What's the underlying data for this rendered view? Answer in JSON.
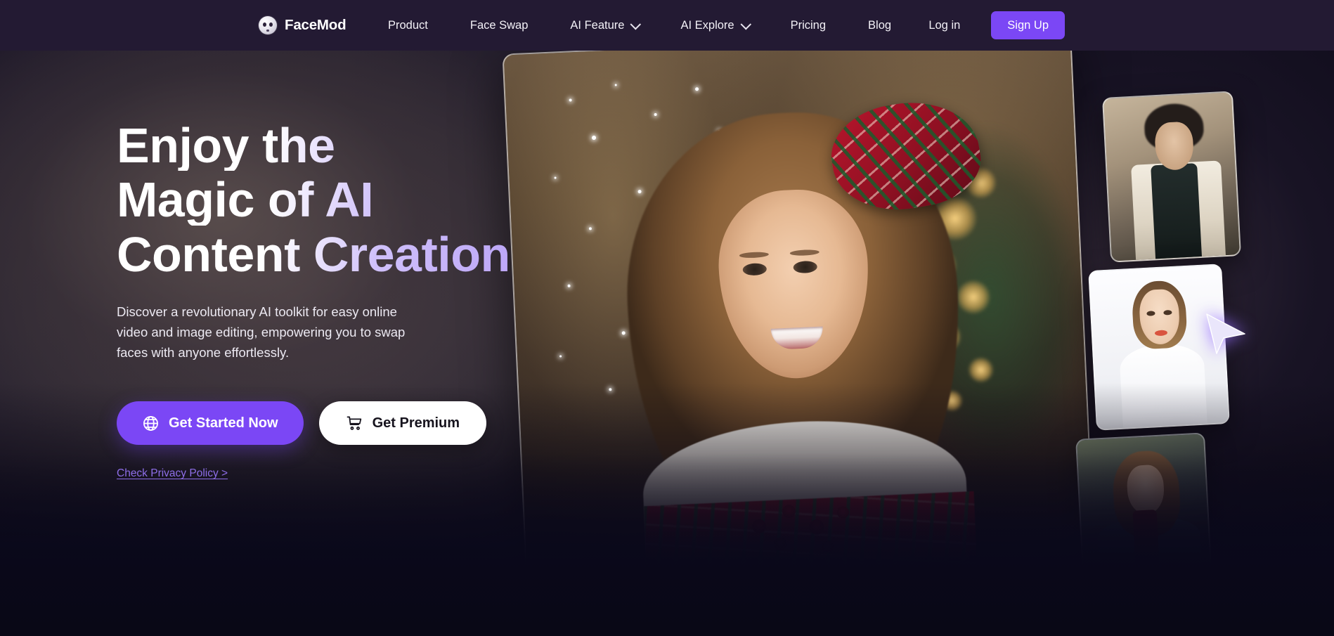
{
  "brand": {
    "name": "FaceMod",
    "logo_icon": "face-circle-icon"
  },
  "nav": {
    "links": [
      {
        "label": "Product",
        "has_dropdown": false
      },
      {
        "label": "Face Swap",
        "has_dropdown": false
      },
      {
        "label": "AI Feature",
        "has_dropdown": true
      },
      {
        "label": "AI Explore",
        "has_dropdown": true
      },
      {
        "label": "Pricing",
        "has_dropdown": false
      },
      {
        "label": "Blog",
        "has_dropdown": false
      }
    ],
    "login_label": "Log in",
    "signup_label": "Sign Up",
    "bar_color": "#231a33",
    "accent_color": "#7b47f5"
  },
  "hero": {
    "headline_line1": "Enjoy the",
    "headline_line2": "Magic of AI",
    "headline_line3": "Content Creation",
    "subtext": "Discover a revolutionary AI toolkit for easy online video and image editing, empowering you to swap faces with anyone effortlessly.",
    "primary_cta": "Get Started Now",
    "primary_cta_icon": "globe-icon",
    "secondary_cta": "Get Premium",
    "secondary_cta_icon": "shopping-cart-icon",
    "privacy_link": "Check Privacy Policy >",
    "headline_gradient_start": "#ffffff",
    "headline_gradient_end": "#b59cf7",
    "link_color": "#8e6ee8"
  },
  "gallery": {
    "main_image_alt": "Smiling girl with plaid bow and festive bokeh background",
    "thumbnails": [
      {
        "alt": "Victorian styled man in waistcoat"
      },
      {
        "alt": "Woman portrait on white background"
      },
      {
        "alt": "Woman in denim jacket with red scarf"
      }
    ],
    "cursor_icon": "cursor-arrow-icon"
  }
}
